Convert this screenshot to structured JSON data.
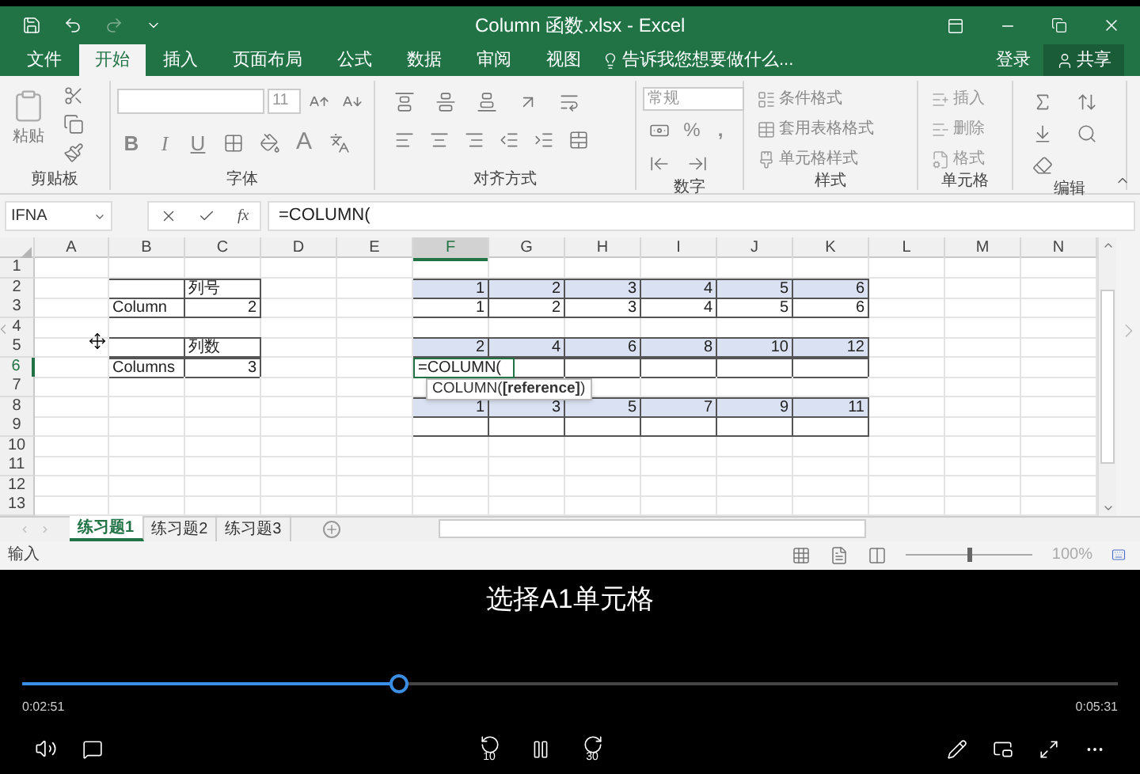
{
  "window": {
    "title": "Column 函数.xlsx - Excel"
  },
  "ribbon_tabs": [
    {
      "label": "文件",
      "selected": false
    },
    {
      "label": "开始",
      "selected": true
    },
    {
      "label": "插入",
      "selected": false
    },
    {
      "label": "页面布局",
      "selected": false
    },
    {
      "label": "公式",
      "selected": false
    },
    {
      "label": "数据",
      "selected": false
    },
    {
      "label": "审阅",
      "selected": false
    },
    {
      "label": "视图",
      "selected": false
    }
  ],
  "tell_me": {
    "placeholder": "告诉我您想要做什么..."
  },
  "sign_in": "登录",
  "share": "共享",
  "ribbon_groups": [
    {
      "label": "剪贴板",
      "kind": "clipboard",
      "paste": "粘贴"
    },
    {
      "label": "字体",
      "kind": "font",
      "font_size": "11",
      "bold": "B",
      "italic": "I",
      "underline": "U",
      "font_color": "A"
    },
    {
      "label": "对齐方式",
      "kind": "alignment"
    },
    {
      "label": "数字",
      "kind": "number",
      "format": "常规",
      "percent": "%",
      "comma": ","
    },
    {
      "label": "样式",
      "kind": "styles",
      "items": [
        "条件格式",
        "套用表格格式",
        "单元格样式"
      ]
    },
    {
      "label": "单元格",
      "kind": "cells",
      "items": [
        "插入",
        "删除",
        "格式"
      ]
    },
    {
      "label": "编辑",
      "kind": "editing"
    }
  ],
  "formula_bar": {
    "name_box": "IFNA",
    "fx": "fx",
    "formula": "=COLUMN("
  },
  "sheet": {
    "columns": [
      {
        "label": "A",
        "selected": false
      },
      {
        "label": "B",
        "selected": false
      },
      {
        "label": "C",
        "selected": false
      },
      {
        "label": "D",
        "selected": false
      },
      {
        "label": "E",
        "selected": false
      },
      {
        "label": "F",
        "selected": true
      },
      {
        "label": "G",
        "selected": false
      },
      {
        "label": "H",
        "selected": false
      },
      {
        "label": "I",
        "selected": false
      },
      {
        "label": "J",
        "selected": false
      },
      {
        "label": "K",
        "selected": false
      },
      {
        "label": "L",
        "selected": false
      },
      {
        "label": "M",
        "selected": false
      },
      {
        "label": "N",
        "selected": false
      }
    ],
    "rows": [
      {
        "label": "1",
        "selected": false,
        "cells": []
      },
      {
        "label": "2",
        "selected": false,
        "cells": [
          null,
          {
            "kind": "bordered"
          },
          {
            "kind": "bordered",
            "text": "列号",
            "is_text": true
          },
          null,
          null,
          {
            "kind": "shaded",
            "text": "1"
          },
          {
            "kind": "shaded",
            "text": "2"
          },
          {
            "kind": "shaded",
            "text": "3"
          },
          {
            "kind": "shaded",
            "text": "4"
          },
          {
            "kind": "shaded",
            "text": "5"
          },
          {
            "kind": "shaded",
            "text": "6"
          }
        ]
      },
      {
        "label": "3",
        "selected": false,
        "cells": [
          null,
          {
            "kind": "bordered",
            "text": "Column",
            "is_text": true
          },
          {
            "kind": "bordered",
            "text": "2"
          },
          null,
          null,
          {
            "kind": "bordered",
            "text": "1"
          },
          {
            "kind": "bordered",
            "text": "2"
          },
          {
            "kind": "bordered",
            "text": "3"
          },
          {
            "kind": "bordered",
            "text": "4"
          },
          {
            "kind": "bordered",
            "text": "5"
          },
          {
            "kind": "bordered",
            "text": "6"
          }
        ]
      },
      {
        "label": "4",
        "selected": false,
        "cells": []
      },
      {
        "label": "5",
        "selected": false,
        "cells": [
          null,
          {
            "kind": "bordered"
          },
          {
            "kind": "bordered",
            "text": "列数",
            "is_text": true
          },
          null,
          null,
          {
            "kind": "shaded",
            "text": "2"
          },
          {
            "kind": "shaded",
            "text": "4"
          },
          {
            "kind": "shaded",
            "text": "6"
          },
          {
            "kind": "shaded",
            "text": "8"
          },
          {
            "kind": "shaded",
            "text": "10"
          },
          {
            "kind": "shaded",
            "text": "12"
          }
        ]
      },
      {
        "label": "6",
        "selected": true,
        "cells": [
          null,
          {
            "kind": "bordered",
            "text": "Columns",
            "is_text": true
          },
          {
            "kind": "bordered",
            "text": "3"
          },
          null,
          null,
          {
            "kind": "editing",
            "text": "=COLUMN(",
            "is_text": true
          },
          {
            "kind": "bordered"
          },
          {
            "kind": "bordered"
          },
          {
            "kind": "bordered"
          },
          {
            "kind": "bordered"
          },
          {
            "kind": "bordered"
          }
        ]
      },
      {
        "label": "7",
        "selected": false,
        "cells": []
      },
      {
        "label": "8",
        "selected": false,
        "cells": [
          null,
          null,
          null,
          null,
          null,
          {
            "kind": "shaded",
            "text": "1"
          },
          {
            "kind": "shaded",
            "text": "3"
          },
          {
            "kind": "shaded",
            "text": "5"
          },
          {
            "kind": "shaded",
            "text": "7"
          },
          {
            "kind": "shaded",
            "text": "9"
          },
          {
            "kind": "shaded",
            "text": "11"
          }
        ]
      },
      {
        "label": "9",
        "selected": false,
        "cells": [
          null,
          null,
          null,
          null,
          null,
          {
            "kind": "bordered"
          },
          {
            "kind": "bordered"
          },
          {
            "kind": "bordered"
          },
          {
            "kind": "bordered"
          },
          {
            "kind": "bordered"
          },
          {
            "kind": "bordered"
          }
        ]
      },
      {
        "label": "10",
        "selected": false,
        "cells": []
      },
      {
        "label": "11",
        "selected": false,
        "cells": []
      },
      {
        "label": "12",
        "selected": false,
        "cells": []
      },
      {
        "label": "13",
        "selected": false,
        "cells": []
      }
    ],
    "tooltip": "COLUMN(**[reference]**)"
  },
  "sheet_tabs": [
    {
      "label": "练习题1",
      "selected": true
    },
    {
      "label": "练习题2",
      "selected": false
    },
    {
      "label": "练习题3",
      "selected": false
    }
  ],
  "status_bar": {
    "mode": "输入",
    "zoom": "100%",
    "zoom_slider": {
      "level": 0.5
    }
  },
  "video": {
    "subtitle": "选择A1单元格",
    "elapsed": "0:02:51",
    "duration": "0:05:31",
    "level": 0.344,
    "rewind": "10",
    "forward": "30"
  }
}
